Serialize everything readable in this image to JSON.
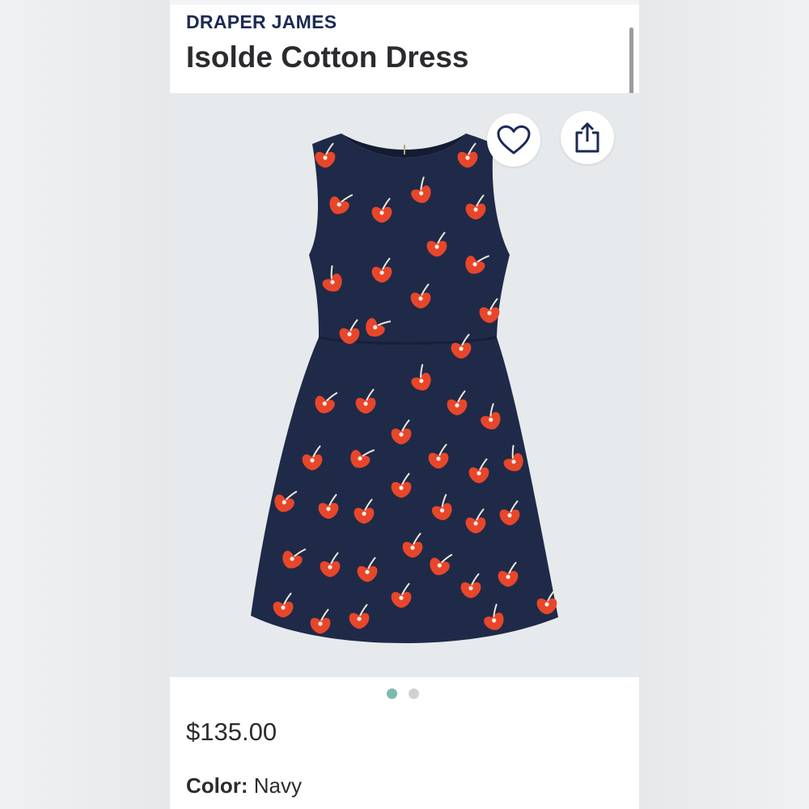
{
  "product": {
    "brand": "DRAPER JAMES",
    "name": "Isolde Cotton Dress",
    "price": "$135.00",
    "color_label": "Color:",
    "color_value": "Navy"
  },
  "gallery": {
    "image_count": 2,
    "active_index": 0,
    "image_subject": "navy sleeveless dress with red poppy print"
  },
  "icons": {
    "favorite": "heart-icon",
    "share": "share-icon"
  },
  "colors": {
    "brand_text": "#1c2a55",
    "dress_navy": "#1f2a48",
    "poppy_red": "#e8462a",
    "active_dot": "#7fb8ae",
    "inactive_dot": "#cfd2d4"
  }
}
